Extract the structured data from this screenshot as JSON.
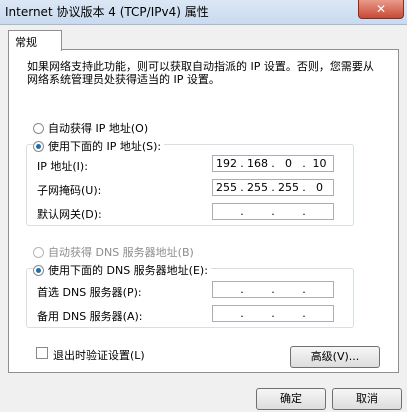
{
  "window": {
    "title": "Internet 协议版本 4 (TCP/IPv4) 属性",
    "close_icon": "close-icon"
  },
  "tab": {
    "general": "常规"
  },
  "description": "如果网络支持此功能，则可以获取自动指派的 IP 设置。否则，您需要从网络系统管理员处获得适当的 IP 设置。",
  "ip": {
    "auto_label": "自动获得 IP 地址(O)",
    "manual_label": "使用下面的 IP 地址(S):",
    "address_label": "IP 地址(I):",
    "subnet_label": "子网掩码(U):",
    "gateway_label": "默认网关(D):",
    "address": [
      "192",
      "168",
      "0",
      "10"
    ],
    "subnet": [
      "255",
      "255",
      "255",
      "0"
    ],
    "gateway": [
      "",
      "",
      "",
      ""
    ]
  },
  "dns": {
    "auto_label": "自动获得 DNS 服务器地址(B)",
    "manual_label": "使用下面的 DNS 服务器地址(E):",
    "preferred_label": "首选 DNS 服务器(P):",
    "alternate_label": "备用 DNS 服务器(A):",
    "preferred": [
      "",
      "",
      "",
      ""
    ],
    "alternate": [
      "",
      "",
      "",
      ""
    ]
  },
  "validate_label": "退出时验证设置(L)",
  "advanced_label": "高级(V)...",
  "ok_label": "确定",
  "cancel_label": "取消"
}
